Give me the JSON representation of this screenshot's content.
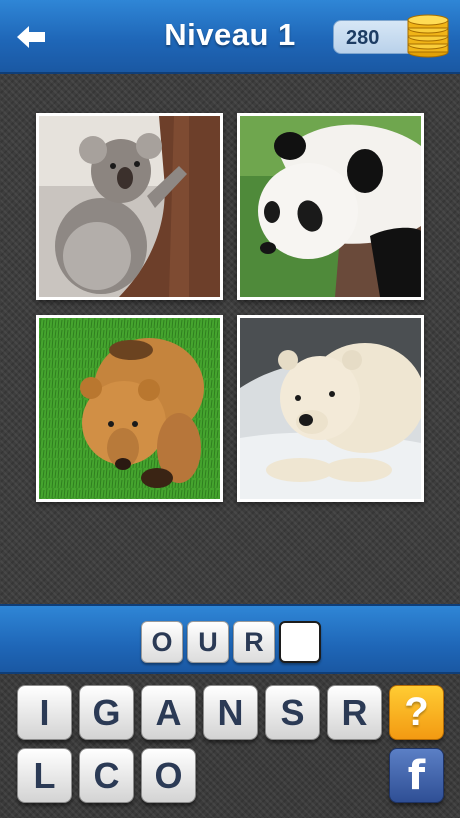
{
  "header": {
    "back_icon": "arrow-left-icon",
    "title": "Niveau 1",
    "coins": "280",
    "coins_icon": "gold-coins-icon"
  },
  "photos": [
    {
      "subject": "koala",
      "icon": "koala-photo"
    },
    {
      "subject": "panda",
      "icon": "panda-photo"
    },
    {
      "subject": "brown bear",
      "icon": "brown-bear-photo"
    },
    {
      "subject": "polar bear",
      "icon": "polar-bear-photo"
    }
  ],
  "answer": {
    "letters": [
      "O",
      "U",
      "R",
      ""
    ]
  },
  "keyboard": {
    "row1": [
      "I",
      "G",
      "A",
      "N",
      "S",
      "R"
    ],
    "row2": [
      "L",
      "C",
      "O"
    ],
    "help_label": "?",
    "facebook_label": "f"
  },
  "colors": {
    "header_blue": "#1f67b8",
    "help_orange": "#f39a12",
    "facebook_blue": "#3b5998",
    "letter_color": "#2b3a55"
  }
}
